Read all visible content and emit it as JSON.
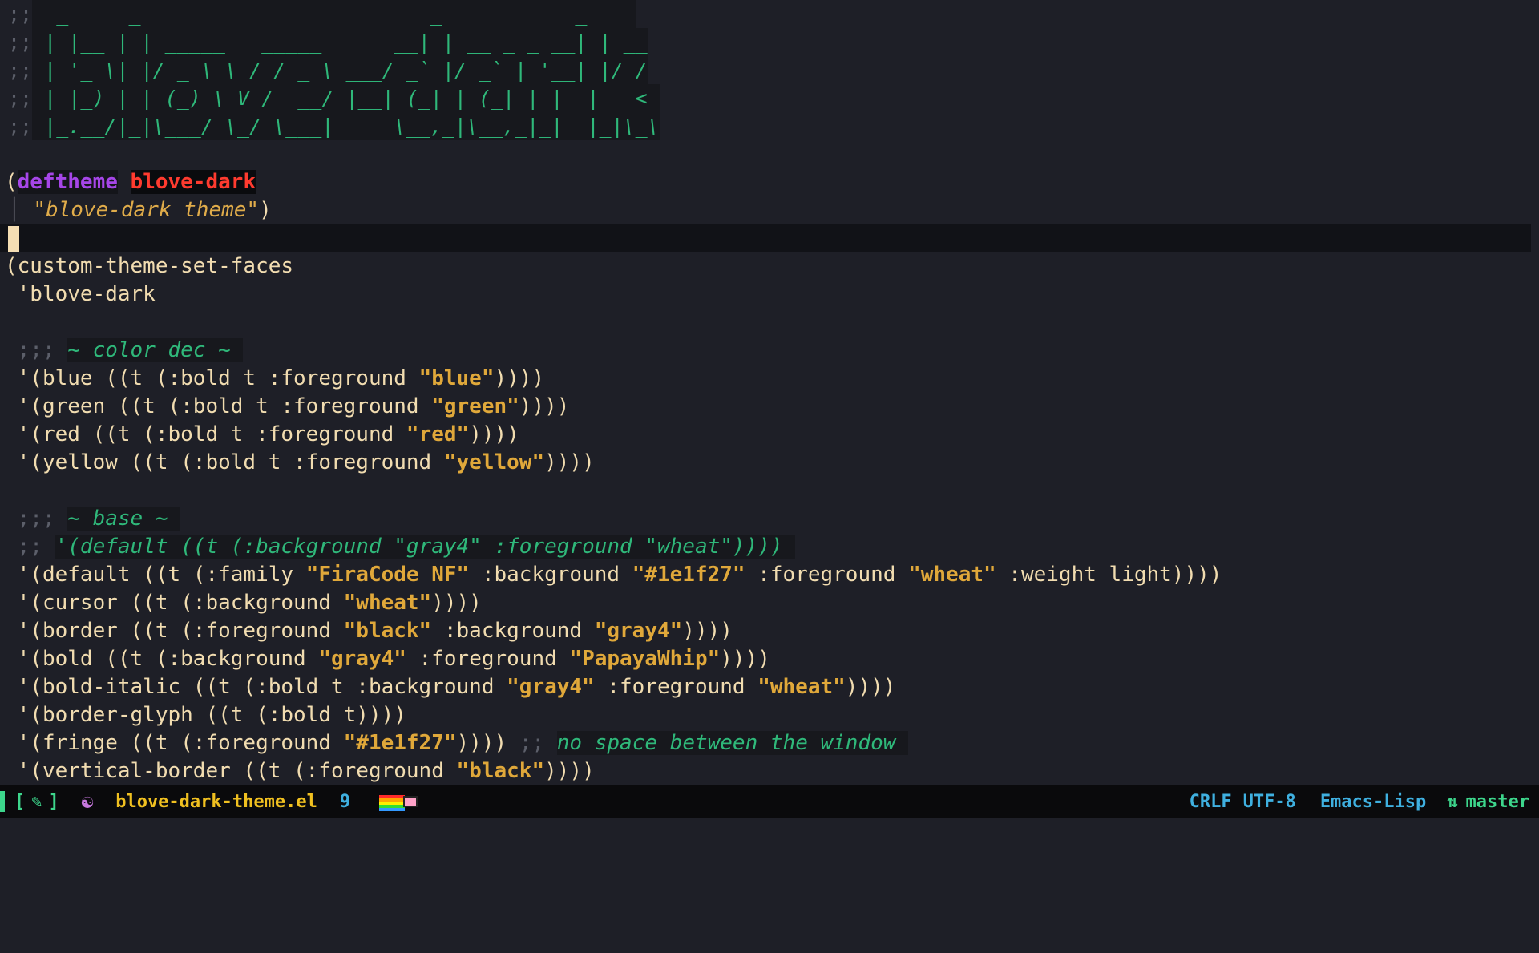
{
  "banner": {
    "prefix": ";;",
    "lines": [
      "  _     _                        _           _    ",
      " | |__ | | _____   _____      __| | __ _ _ __| | __",
      " | '_ \\| |/ _ \\ \\ / / _ \\ ___/ _` |/ _` | '__| |/ /",
      " | |_) | | (_) \\ V /  __/ |__| (_| | (_| | |  |   < ",
      " |_.__/|_|\\___/ \\_/ \\___|     \\__,_|\\__,_|_|  |_|\\_\\"
    ]
  },
  "deftheme": {
    "open": "(",
    "keyword": "deftheme",
    "name": "blove-dark",
    "guide": "│",
    "doc": "\"blove-dark theme\"",
    "close": ")"
  },
  "faces": {
    "head": "(custom-theme-set-faces",
    "theme": " 'blove-dark",
    "color_comment_prefix": " ;;; ",
    "color_comment": "~ color dec ~ ",
    "colors": [
      {
        "pre": " '(blue ((t (:bold t :foreground ",
        "str": "\"blue\"",
        "post": "))))"
      },
      {
        "pre": " '(green ((t (:bold t :foreground ",
        "str": "\"green\"",
        "post": "))))"
      },
      {
        "pre": " '(red ((t (:bold t :foreground ",
        "str": "\"red\"",
        "post": "))))"
      },
      {
        "pre": " '(yellow ((t (:bold t :foreground ",
        "str": "\"yellow\"",
        "post": "))))"
      }
    ],
    "base_comment_prefix": " ;;; ",
    "base_comment": "~ base ~ ",
    "default_comment_prefix": " ;; ",
    "default_comment": "'(default ((t (:background \"gray4\" :foreground \"wheat\")))) ",
    "default": {
      "a": " '(default ((t (:family ",
      "s1": "\"FiraCode NF\"",
      "b": " :background ",
      "s2": "\"#1e1f27\"",
      "c": " :foreground ",
      "s3": "\"wheat\"",
      "d": " :weight light))))"
    },
    "cursor": {
      "a": " '(cursor ((t (:background ",
      "s1": "\"wheat\"",
      "b": "))))"
    },
    "border": {
      "a": " '(border ((t (:foreground ",
      "s1": "\"black\"",
      "b": " :background ",
      "s2": "\"gray4\"",
      "c": "))))"
    },
    "bold": {
      "a": " '(bold ((t (:background ",
      "s1": "\"gray4\"",
      "b": " :foreground ",
      "s2": "\"PapayaWhip\"",
      "c": "))))"
    },
    "bold_italic": {
      "a": " '(bold-italic ((t (:bold t :background ",
      "s1": "\"gray4\"",
      "b": " :foreground ",
      "s2": "\"wheat\"",
      "c": "))))"
    },
    "border_glyph": " '(border-glyph ((t (:bold t))))",
    "fringe": {
      "a": " '(fringe ((t (:foreground ",
      "s1": "\"#1e1f27\"",
      "b": ")))) ",
      "cprefix": ";; ",
      "comment": "no space between the window "
    },
    "vertical_border": {
      "a": " '(vertical-border ((t (:foreground ",
      "s1": "\"black\"",
      "b": "))))"
    }
  },
  "modeline": {
    "open_bracket": "[",
    "leaf_icon": "✎",
    "close_bracket": "]",
    "emacs_icon": "☯",
    "filename": "blove-dark-theme.el",
    "line_number": "9",
    "eol": "CRLF",
    "encoding": "UTF-8",
    "major_mode": "Emacs-Lisp",
    "git_icon": "⇅",
    "branch": "master"
  },
  "colors": {
    "background": "#1e1f27",
    "foreground": "#f1dcb0",
    "keyword": "#a646e8",
    "theme_name": "#ff3b2f",
    "string": "#e0a83a",
    "comment": "#2fb87a",
    "modeline_accent": "#3fb0e0",
    "modeline_green": "#3dd68c",
    "modeline_file": "#f0c020"
  }
}
